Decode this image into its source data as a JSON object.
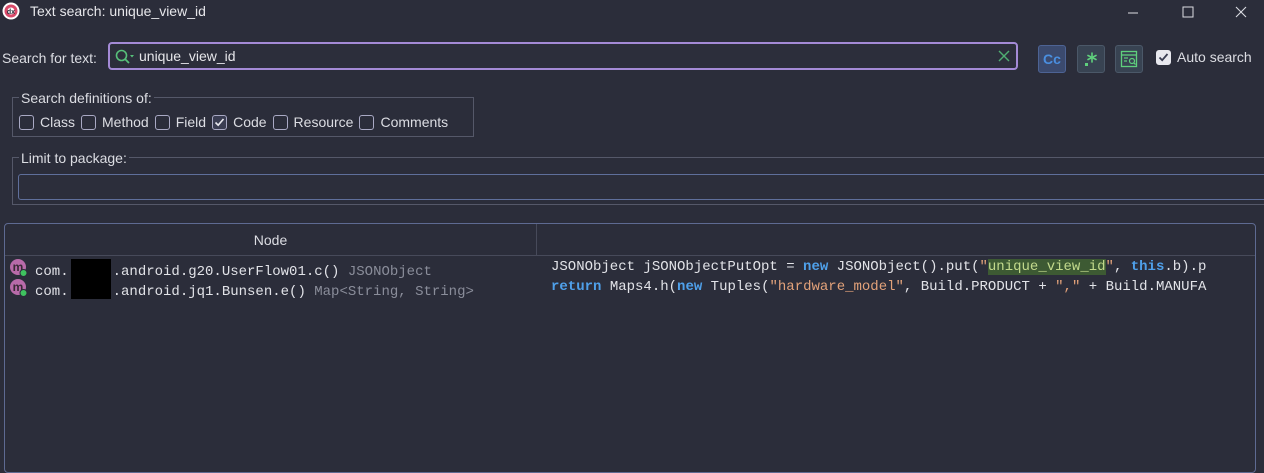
{
  "window": {
    "title": "Text search: unique_view_id"
  },
  "search": {
    "label": "Search for text:",
    "value": "unique_view_id",
    "auto_search_label": "Auto search",
    "auto_search_checked": true
  },
  "options": {
    "case_button_label": "Cc"
  },
  "definitions": {
    "title": "Search definitions of:",
    "items": [
      {
        "label": "Class",
        "checked": false
      },
      {
        "label": "Method",
        "checked": false
      },
      {
        "label": "Field",
        "checked": false
      },
      {
        "label": "Code",
        "checked": true
      },
      {
        "label": "Resource",
        "checked": false
      },
      {
        "label": "Comments",
        "checked": false
      }
    ]
  },
  "package": {
    "title": "Limit to package:",
    "value": ""
  },
  "results": {
    "column_node": "Node",
    "column_code": "",
    "rows": [
      {
        "node_prefix": "com.",
        "node_suffix": ".android.g20.UserFlow01.c()",
        "node_type": "JSONObject",
        "code": [
          {
            "t": "JSONObject jSONObjectPutOpt = ",
            "c": "plain"
          },
          {
            "t": "new",
            "c": "kw"
          },
          {
            "t": " JSONObject().put(",
            "c": "plain"
          },
          {
            "t": "\"",
            "c": "str"
          },
          {
            "t": "unique_view_id",
            "c": "hl"
          },
          {
            "t": "\"",
            "c": "str"
          },
          {
            "t": ", ",
            "c": "plain"
          },
          {
            "t": "this",
            "c": "kw"
          },
          {
            "t": ".b).p",
            "c": "plain"
          }
        ]
      },
      {
        "node_prefix": "com.",
        "node_suffix": ".android.jq1.Bunsen.e()",
        "node_type": "Map<String, String>",
        "code": [
          {
            "t": "return",
            "c": "kw"
          },
          {
            "t": " Maps4.h(",
            "c": "plain"
          },
          {
            "t": "new",
            "c": "kw"
          },
          {
            "t": " Tuples(",
            "c": "plain"
          },
          {
            "t": "\"hardware_model\"",
            "c": "str"
          },
          {
            "t": ", Build.PRODUCT + ",
            "c": "plain"
          },
          {
            "t": "\",\"",
            "c": "str"
          },
          {
            "t": " + Build.MANUFA",
            "c": "plain"
          }
        ]
      }
    ]
  },
  "colors": {
    "background": "#2b2d3a",
    "accent": "#a48ad6",
    "keyword": "#4fa0ea",
    "string": "#e3a27a",
    "highlight_bg": "#3d5a33"
  },
  "icons": {
    "app": "jadx-logo-icon",
    "search": "search-icon",
    "clear": "clear-x-icon",
    "regex": "regex-star-icon",
    "active_tab": "search-in-active-tab-icon",
    "method": "method-icon"
  }
}
